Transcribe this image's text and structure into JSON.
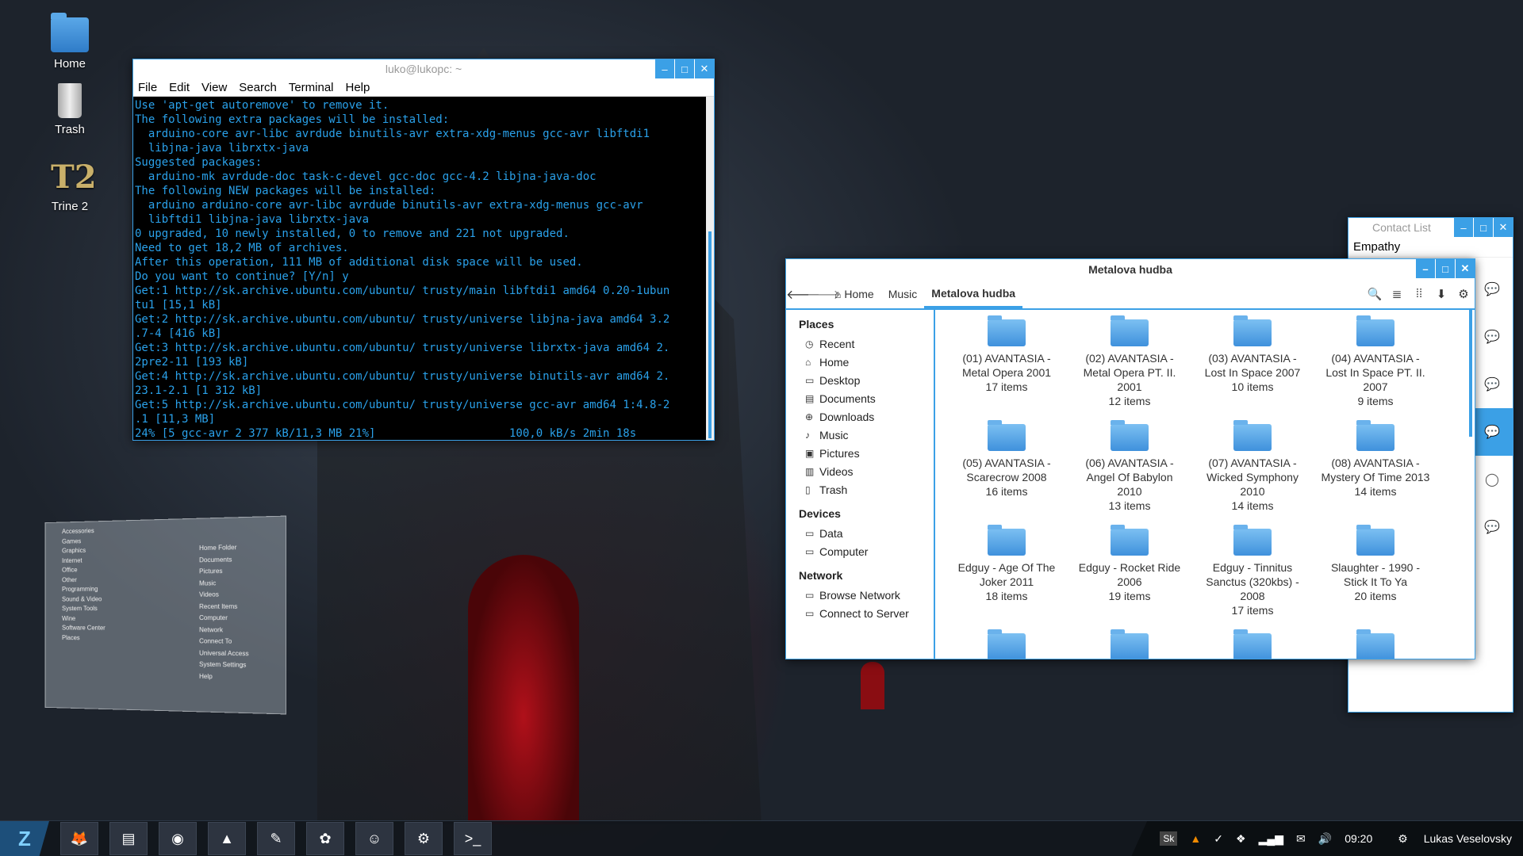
{
  "desktop": {
    "icons": [
      {
        "label": "Home",
        "icon": "home-folder-icon"
      },
      {
        "label": "Trash",
        "icon": "trash-icon"
      },
      {
        "label": "Trine 2",
        "icon": "trine2-icon"
      }
    ]
  },
  "terminal": {
    "title": "luko@lukopc: ~",
    "menu": [
      "File",
      "Edit",
      "View",
      "Search",
      "Terminal",
      "Help"
    ],
    "lines": [
      "Use 'apt-get autoremove' to remove it.",
      "The following extra packages will be installed:",
      "  arduino-core avr-libc avrdude binutils-avr extra-xdg-menus gcc-avr libftdi1",
      "  libjna-java librxtx-java",
      "Suggested packages:",
      "  arduino-mk avrdude-doc task-c-devel gcc-doc gcc-4.2 libjna-java-doc",
      "The following NEW packages will be installed:",
      "  arduino arduino-core avr-libc avrdude binutils-avr extra-xdg-menus gcc-avr",
      "  libftdi1 libjna-java librxtx-java",
      "0 upgraded, 10 newly installed, 0 to remove and 221 not upgraded.",
      "Need to get 18,2 MB of archives.",
      "After this operation, 111 MB of additional disk space will be used.",
      "Do you want to continue? [Y/n] y",
      "Get:1 http://sk.archive.ubuntu.com/ubuntu/ trusty/main libftdi1 amd64 0.20-1ubun",
      "tu1 [15,1 kB]",
      "Get:2 http://sk.archive.ubuntu.com/ubuntu/ trusty/universe libjna-java amd64 3.2",
      ".7-4 [416 kB]",
      "Get:3 http://sk.archive.ubuntu.com/ubuntu/ trusty/universe librxtx-java amd64 2.",
      "2pre2-11 [193 kB]",
      "Get:4 http://sk.archive.ubuntu.com/ubuntu/ trusty/universe binutils-avr amd64 2.",
      "23.1-2.1 [1 312 kB]",
      "Get:5 http://sk.archive.ubuntu.com/ubuntu/ trusty/universe gcc-avr amd64 1:4.8-2",
      ".1 [11,3 MB]",
      "24% [5 gcc-avr 2 377 kB/11,3 MB 21%]                    100,0 kB/s 2min 18s"
    ]
  },
  "whisker": {
    "categories": [
      "Accessories",
      "Games",
      "Graphics",
      "Internet",
      "Office",
      "Other",
      "Programming",
      "Sound & Video",
      "System Tools",
      "Wine",
      "Software Center",
      "Places"
    ],
    "places": [
      "Home Folder",
      "Documents",
      "Pictures",
      "Music",
      "Videos",
      "Recent Items",
      "Computer",
      "Network",
      "Connect To",
      "Universal Access",
      "System Settings",
      "Help"
    ]
  },
  "contacts": {
    "title": "Contact List",
    "name": "Empathy"
  },
  "files": {
    "title": "Metalova hudba",
    "breadcrumbs": [
      "Home",
      "Music",
      "Metalova hudba"
    ],
    "places_header": "Places",
    "places": [
      {
        "label": "Recent",
        "icon": "clock-icon",
        "glyph": "◷"
      },
      {
        "label": "Home",
        "icon": "home-icon",
        "glyph": "⌂"
      },
      {
        "label": "Desktop",
        "icon": "desktop-icon",
        "glyph": "▭"
      },
      {
        "label": "Documents",
        "icon": "documents-icon",
        "glyph": "▤"
      },
      {
        "label": "Downloads",
        "icon": "download-icon",
        "glyph": "⊕"
      },
      {
        "label": "Music",
        "icon": "music-icon",
        "glyph": "♪"
      },
      {
        "label": "Pictures",
        "icon": "pictures-icon",
        "glyph": "▣"
      },
      {
        "label": "Videos",
        "icon": "videos-icon",
        "glyph": "▥"
      },
      {
        "label": "Trash",
        "icon": "trash-icon",
        "glyph": "▯"
      }
    ],
    "devices_header": "Devices",
    "devices": [
      {
        "label": "Data",
        "icon": "drive-icon",
        "glyph": "▭"
      },
      {
        "label": "Computer",
        "icon": "computer-icon",
        "glyph": "▭"
      }
    ],
    "network_header": "Network",
    "network": [
      {
        "label": "Browse Network",
        "icon": "network-icon",
        "glyph": "▭"
      },
      {
        "label": "Connect to Server",
        "icon": "server-icon",
        "glyph": "▭"
      }
    ],
    "folders": [
      {
        "name": "(01) AVANTASIA - Metal Opera  2001",
        "count": "17 items"
      },
      {
        "name": "(02) AVANTASIA - Metal Opera PT. II. 2001",
        "count": "12 items"
      },
      {
        "name": "(03) AVANTASIA - Lost In Space  2007",
        "count": "10 items"
      },
      {
        "name": "(04) AVANTASIA - Lost In Space PT. II.  2007",
        "count": "9 items"
      },
      {
        "name": "(05) AVANTASIA - Scarecrow  2008",
        "count": "16 items"
      },
      {
        "name": "(06) AVANTASIA - Angel Of Babylon 2010",
        "count": "13 items"
      },
      {
        "name": "(07) AVANTASIA - Wicked Symphony 2010",
        "count": "14 items"
      },
      {
        "name": "(08) AVANTASIA - Mystery Of Time 2013",
        "count": "14 items"
      },
      {
        "name": "Edguy - Age Of The Joker 2011",
        "count": "18 items"
      },
      {
        "name": "Edguy - Rocket Ride 2006",
        "count": "19 items"
      },
      {
        "name": "Edguy - Tinnitus Sanctus (320kbs) - 2008",
        "count": "17 items"
      },
      {
        "name": "Slaughter - 1990 - Stick It To Ya",
        "count": "20 items"
      },
      {
        "name": "",
        "count": ""
      },
      {
        "name": "",
        "count": ""
      },
      {
        "name": "",
        "count": ""
      },
      {
        "name": "",
        "count": ""
      }
    ]
  },
  "taskbar": {
    "apps": [
      {
        "name": "firefox",
        "icon": "firefox-icon",
        "glyph": "🦊"
      },
      {
        "name": "files",
        "icon": "file-manager-icon",
        "glyph": "▤"
      },
      {
        "name": "audio",
        "icon": "speaker-icon",
        "glyph": "◉"
      },
      {
        "name": "vlc",
        "icon": "vlc-icon",
        "glyph": "▲"
      },
      {
        "name": "editor",
        "icon": "text-editor-icon",
        "glyph": "✎"
      },
      {
        "name": "software",
        "icon": "software-center-icon",
        "glyph": "✿"
      },
      {
        "name": "empathy",
        "icon": "chat-icon",
        "glyph": "☺"
      },
      {
        "name": "steam",
        "icon": "steam-icon",
        "glyph": "⚙"
      },
      {
        "name": "terminal",
        "icon": "terminal-icon",
        "glyph": ">_"
      }
    ],
    "tray": {
      "keyboard": "Sk",
      "time": "09:20",
      "user": "Lukas Veselovsky"
    }
  }
}
